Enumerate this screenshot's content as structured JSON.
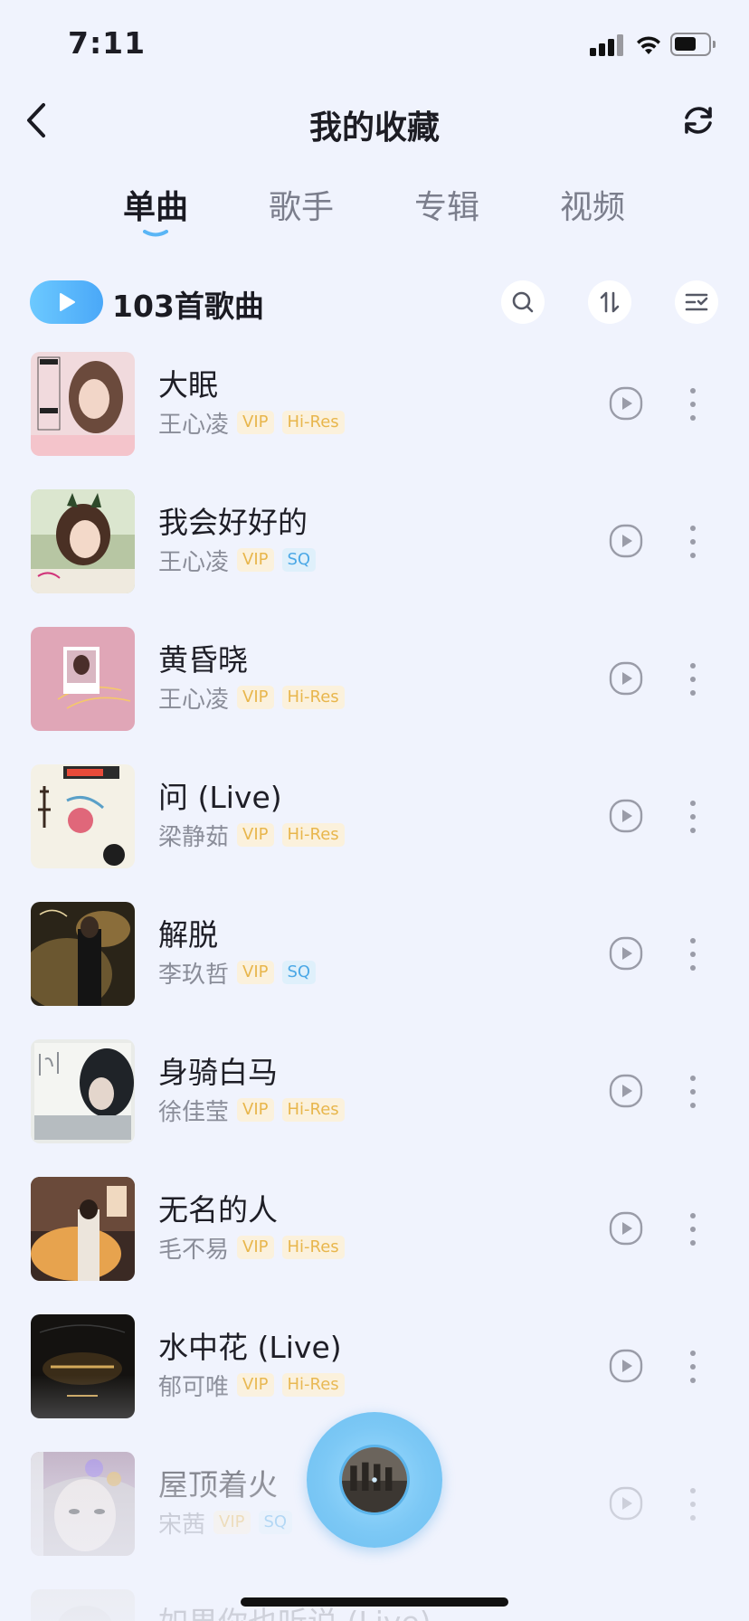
{
  "status": {
    "time": "7:11"
  },
  "header": {
    "title": "我的收藏"
  },
  "tabs": [
    {
      "label": "单曲",
      "active": true
    },
    {
      "label": "歌手",
      "active": false
    },
    {
      "label": "专辑",
      "active": false
    },
    {
      "label": "视频",
      "active": false
    }
  ],
  "toolbar": {
    "song_count": "103首歌曲"
  },
  "songs": [
    {
      "title": "大眠",
      "artist": "王心凌",
      "badges": [
        "VIP",
        "Hi-Res"
      ]
    },
    {
      "title": "我会好好的",
      "artist": "王心凌",
      "badges": [
        "VIP",
        "SQ"
      ]
    },
    {
      "title": "黄昏晓",
      "artist": "王心凌",
      "badges": [
        "VIP",
        "Hi-Res"
      ]
    },
    {
      "title": "问 (Live)",
      "artist": "梁静茹",
      "badges": [
        "VIP",
        "Hi-Res"
      ]
    },
    {
      "title": "解脱",
      "artist": "李玖哲",
      "badges": [
        "VIP",
        "SQ"
      ]
    },
    {
      "title": "身骑白马",
      "artist": "徐佳莹",
      "badges": [
        "VIP",
        "Hi-Res"
      ]
    },
    {
      "title": "无名的人",
      "artist": "毛不易",
      "badges": [
        "VIP",
        "Hi-Res"
      ]
    },
    {
      "title": "水中花 (Live)",
      "artist": "郁可唯",
      "badges": [
        "VIP",
        "Hi-Res"
      ]
    },
    {
      "title": "屋顶着火",
      "artist": "宋茜",
      "badges": [
        "VIP",
        "SQ"
      ]
    },
    {
      "title": "如果你也听说 (Live)",
      "artist": "",
      "badges": []
    }
  ],
  "colors": {
    "background": "#f0f3fd",
    "accent": "#4aa8f8",
    "vip": "#e8b64c",
    "sq": "#4ba8e6"
  },
  "icons": {
    "back": "chevron-left-icon",
    "refresh": "refresh-icon",
    "search": "search-icon",
    "sort": "sort-icon",
    "batch": "checklist-icon",
    "mv": "play-circle-icon",
    "more": "more-vertical-icon"
  }
}
